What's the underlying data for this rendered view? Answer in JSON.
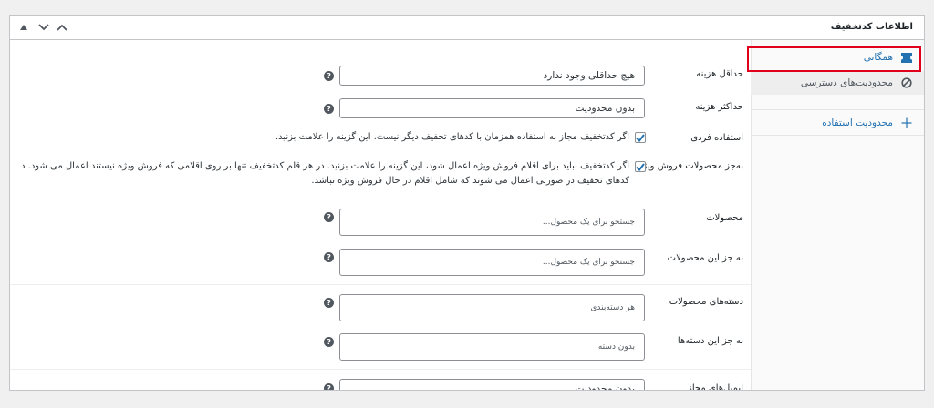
{
  "panel": {
    "title": "اطلاعات کدتخفیف"
  },
  "tabs": [
    {
      "label": "همگانی",
      "icon": "ticket-icon"
    },
    {
      "label": "محدودیت‌های دسترسی",
      "icon": "no-entry-icon"
    },
    {
      "label": "محدودیت استفاده",
      "icon": "plus-icon"
    }
  ],
  "fields": {
    "min_spend": {
      "label": "حداقل هزینه",
      "value": "هیچ حداقلی وجود ندارد"
    },
    "max_spend": {
      "label": "حداکثر هزینه",
      "value": "بدون محدودیت"
    },
    "individual_use": {
      "label": "استفاده فردی",
      "checked": true,
      "description": "اگر کدتخفیف مجاز به استفاده همزمان با کدهای تخفیف دیگر نیست، این گزینه را علامت بزنید."
    },
    "exclude_sale": {
      "label": "به‌جز محصولات فروش ویژه",
      "checked": true,
      "description_line1": "اگر کدتخفیف نباید برای اقلام فروش ویژه اعمال شود، این گزینه را علامت بزنید. در هر قلم کدتخفیف تنها بر روی اقلامی که فروش ویژه نیستند اعمال می شود. در هر سبد خرید",
      "description_line2": "کدهای تخفیف در صورتی اعمال می شوند که شامل اقلام در حال فروش ویژه نباشد."
    },
    "products": {
      "label": "محصولات",
      "placeholder": "جستجو برای یک محصول..."
    },
    "exclude_products": {
      "label": "به جز این محصولات",
      "placeholder": "جستجو برای یک محصول..."
    },
    "categories": {
      "label": "دسته‌های محصولات",
      "placeholder": "هر دسته‌بندی"
    },
    "exclude_categories": {
      "label": "به جز این دسته‌ها",
      "placeholder": "بدون دسته"
    },
    "allowed_emails": {
      "label": "ایمیل‌های مجاز",
      "value": "بدون محدودیت"
    }
  },
  "help_glyph": "?",
  "colors": {
    "link": "#2271b1",
    "highlight": "#e0001b",
    "check": "#2271b1"
  }
}
